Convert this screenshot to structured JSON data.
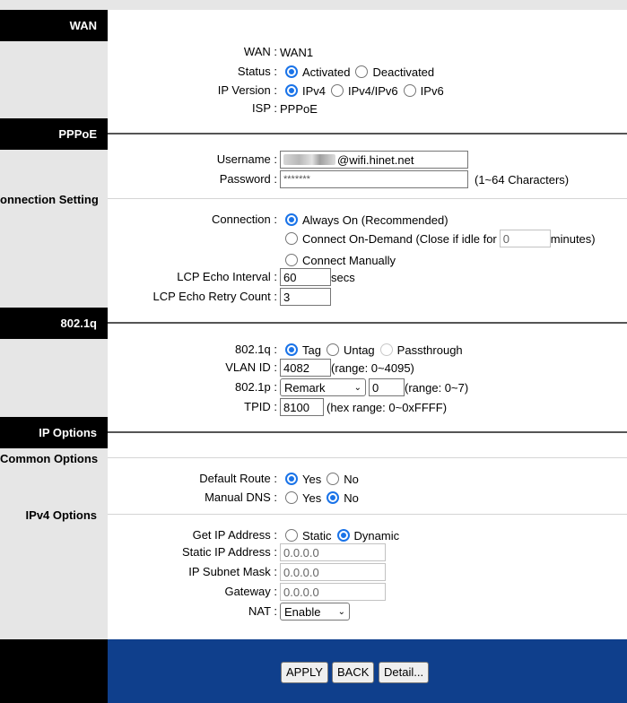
{
  "sections": {
    "wan": "WAN",
    "pppoe": "PPPoE",
    "connection_setting": "onnection Setting",
    "dot1q": "802.1q",
    "ip_options": "IP Options",
    "common_options": "Common Options",
    "ipv4_options": "IPv4 Options"
  },
  "wan": {
    "wan_label": "WAN :",
    "wan_value": "WAN1",
    "status_label": "Status :",
    "status_options": [
      "Activated",
      "Deactivated"
    ],
    "ipversion_label": "IP Version :",
    "ipversion_options": [
      "IPv4",
      "IPv4/IPv6",
      "IPv6"
    ],
    "isp_label": "ISP :",
    "isp_value": "PPPoE"
  },
  "pppoe": {
    "username_label": "Username :",
    "username_value": "@wifi.hinet.net",
    "password_label": "Password :",
    "password_value": "*******",
    "password_hint": "(1~64 Characters)"
  },
  "connection": {
    "label": "Connection :",
    "opt_always": "Always On (Recommended)",
    "opt_ondemand": "Connect On-Demand (Close if idle for",
    "idle_value": "0",
    "idle_unit": "minutes)",
    "opt_manual": "Connect Manually",
    "lcp_interval_label": "LCP Echo Interval :",
    "lcp_interval_value": "60",
    "lcp_interval_unit": "secs",
    "lcp_retry_label": "LCP Echo Retry Count :",
    "lcp_retry_value": "3"
  },
  "dot1q": {
    "label": "802.1q :",
    "options": [
      "Tag",
      "Untag",
      "Passthrough"
    ],
    "vlan_label": "VLAN ID :",
    "vlan_value": "4082",
    "vlan_range": "(range: 0~4095)",
    "dot1p_label": "802.1p :",
    "dot1p_select": "Remark",
    "dot1p_value": "0",
    "dot1p_range": "(range: 0~7)",
    "tpid_label": "TPID :",
    "tpid_value": "8100",
    "tpid_range": "(hex range: 0~0xFFFF)"
  },
  "common": {
    "default_route_label": "Default Route :",
    "manual_dns_label": "Manual DNS :",
    "yes": "Yes",
    "no": "No"
  },
  "ipv4": {
    "get_ip_label": "Get IP Address :",
    "get_ip_options": [
      "Static",
      "Dynamic"
    ],
    "static_ip_label": "Static IP Address :",
    "static_ip_value": "0.0.0.0",
    "subnet_label": "IP Subnet Mask :",
    "subnet_value": "0.0.0.0",
    "gateway_label": "Gateway :",
    "gateway_value": "0.0.0.0",
    "nat_label": "NAT :",
    "nat_value": "Enable"
  },
  "buttons": {
    "apply": "APPLY",
    "back": "BACK",
    "detail": "Detail..."
  },
  "colors": {
    "accent": "#1a73e8",
    "footer": "#0f3f8c",
    "sidebar": "#e6e6e6"
  }
}
